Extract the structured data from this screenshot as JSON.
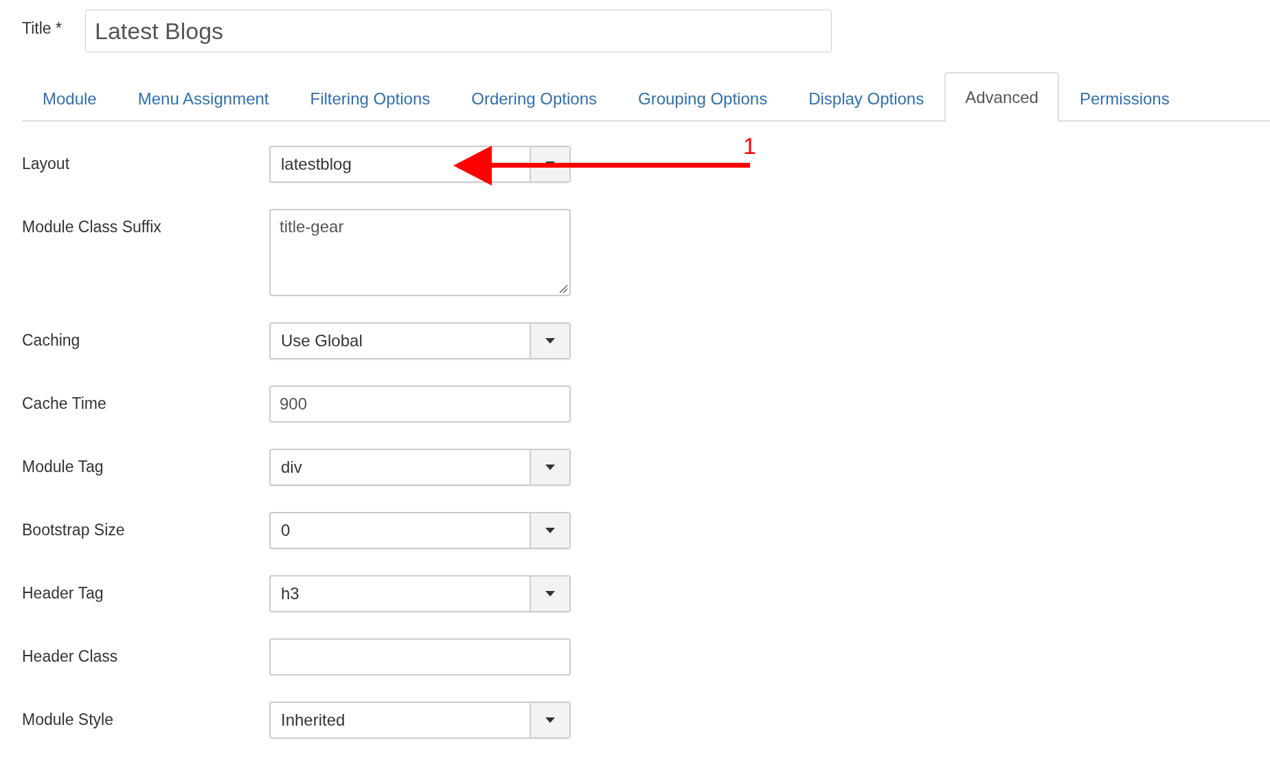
{
  "title_field": {
    "label": "Title *",
    "value": "Latest Blogs"
  },
  "tabs": [
    {
      "label": "Module",
      "selected": false
    },
    {
      "label": "Menu Assignment",
      "selected": false
    },
    {
      "label": "Filtering Options",
      "selected": false
    },
    {
      "label": "Ordering Options",
      "selected": false
    },
    {
      "label": "Grouping Options",
      "selected": false
    },
    {
      "label": "Display Options",
      "selected": false
    },
    {
      "label": "Advanced",
      "selected": true
    },
    {
      "label": "Permissions",
      "selected": false
    }
  ],
  "fields": [
    {
      "label": "Layout",
      "kind": "select",
      "value": "latestblog"
    },
    {
      "label": "Module Class Suffix",
      "kind": "textarea",
      "value": "title-gear"
    },
    {
      "label": "Caching",
      "kind": "select",
      "value": "Use Global"
    },
    {
      "label": "Cache Time",
      "kind": "text",
      "value": "900"
    },
    {
      "label": "Module Tag",
      "kind": "select",
      "value": "div"
    },
    {
      "label": "Bootstrap Size",
      "kind": "select",
      "value": "0"
    },
    {
      "label": "Header Tag",
      "kind": "select",
      "value": "h3"
    },
    {
      "label": "Header Class",
      "kind": "text"
    },
    {
      "label": "Module Style",
      "kind": "select",
      "value": "Inherited"
    }
  ],
  "annotation": {
    "label": "1"
  }
}
